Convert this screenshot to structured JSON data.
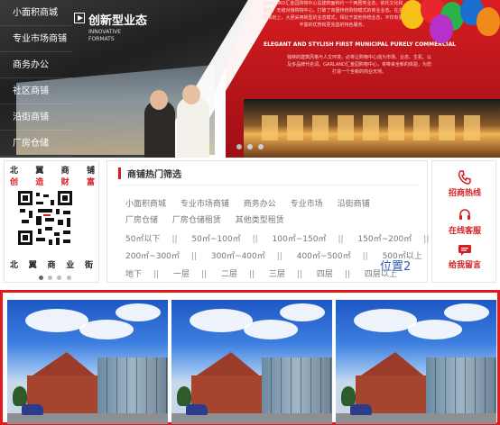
{
  "banner": {
    "nav_items": [
      "小面积商城",
      "专业市场商铺",
      "商务办公",
      "社区商铺",
      "沿街商铺",
      "厂房仓储"
    ],
    "slogan_cn": "创新型业态",
    "slogan_en": "INNOVATIVE FORMATS",
    "intro_text": "GARLAND汇金园购物中心总建筑面积约一个两居类业态，依托文化和教育、无缝对接购物中心，打破了商圈传统购物模式的商业业态。在业态规划上，大胆采用新型的业态模式，相比于其他传统业态，不仅有更丰富的优势和更完善的特色服务。",
    "headline_en": "ELEGANT AND STYLISH FIRST MUNICIPAL PURELY COMMERCIAL",
    "intro_text_2": "独特的建筑风格与人文环境，必将让购物中心成为市场、业态、生机、以及多品牌代名词。GARLAND汇金园购物中心，将带来全新的体验，为您打造一个全新的商业天地。",
    "dots": 3
  },
  "left_card": {
    "row1": [
      "北",
      "翼",
      "商",
      "铺"
    ],
    "row2": [
      "创",
      "造",
      "财",
      "富"
    ],
    "caption": [
      "北",
      "翼",
      "商",
      "业",
      "街"
    ],
    "pager_dots": 4,
    "qr_icon": "qr-code-icon"
  },
  "filter": {
    "title": "商铺热门筛选",
    "row1": [
      "小面积商城",
      "专业市场商铺",
      "商务办公",
      "专业市场",
      "沿街商铺"
    ],
    "row2": [
      "厂房仓储",
      "厂房仓储租赁",
      "其他类型租赁"
    ],
    "row3": [
      "50㎡以下",
      "50㎡~100㎡",
      "100㎡~150㎡",
      "150㎡~200㎡"
    ],
    "row4": [
      "200㎡~300㎡",
      "300㎡~400㎡",
      "400㎡~500㎡",
      "500㎡以上"
    ],
    "row5": [
      "地下",
      "一层",
      "二层",
      "三层",
      "四层",
      "四层以上"
    ],
    "separator": "||",
    "position_label": "位置2"
  },
  "services": [
    {
      "label": "招商热线",
      "icon": "phone-icon"
    },
    {
      "label": "在线客服",
      "icon": "headset-icon"
    },
    {
      "label": "给我留言",
      "icon": "message-icon"
    }
  ],
  "colors": {
    "brand_red": "#d81d21",
    "position_blue": "#2e5dba"
  },
  "gallery": {
    "photo_count": 3
  }
}
